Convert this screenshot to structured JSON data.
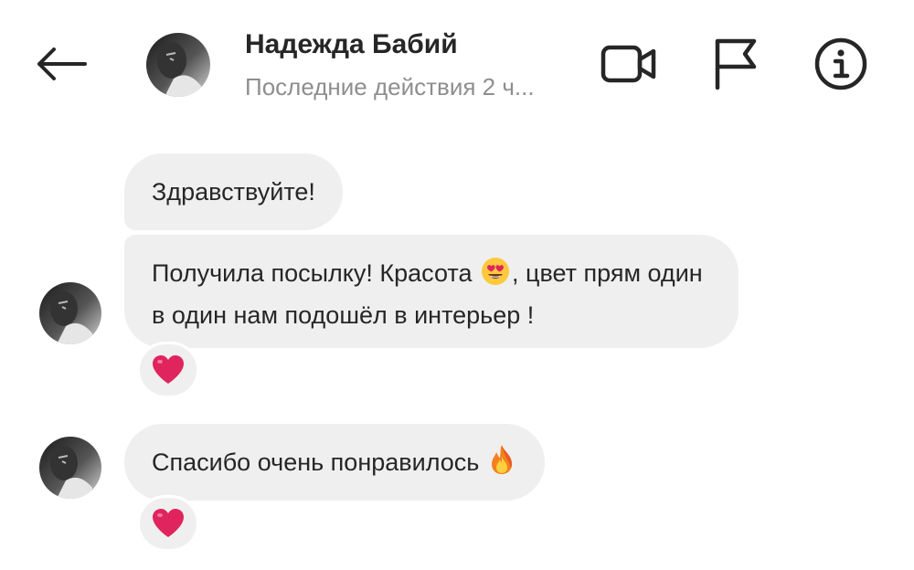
{
  "header": {
    "back_icon": "arrow-left-icon",
    "contact_name": "Надежда Бабий",
    "status": "Последние действия 2 ч...",
    "video_icon": "video-camera-icon",
    "flag_icon": "flag-icon",
    "info_icon": "info-icon"
  },
  "messages": [
    {
      "text": "Здравствуйте!"
    },
    {
      "text_before": "Получила посылку! Красота ",
      "emoji": "smiling-face-with-heart-eyes-icon",
      "text_after": ", цвет прям один в один нам подошёл в интерьер !",
      "reaction": "red-heart-icon"
    },
    {
      "text": "Спасибо очень понравилось ",
      "emoji": "fire-icon",
      "reaction": "red-heart-icon"
    }
  ],
  "colors": {
    "bubble_bg": "#efefef",
    "text": "#262626",
    "secondary_text": "#8e8e8e",
    "heart": "#e0245e"
  }
}
